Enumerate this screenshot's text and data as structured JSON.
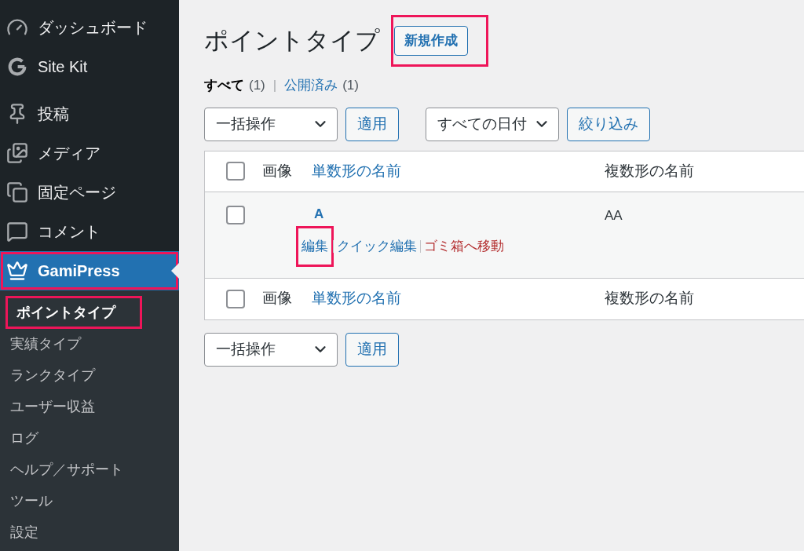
{
  "sidebar": {
    "menu": [
      {
        "label": "ダッシュボード",
        "selected": false,
        "highlighted": false
      },
      {
        "label": "Site Kit",
        "selected": false,
        "highlighted": false
      },
      {
        "label": "投稿",
        "selected": false,
        "highlighted": false
      },
      {
        "label": "メディア",
        "selected": false,
        "highlighted": false
      },
      {
        "label": "固定ページ",
        "selected": false,
        "highlighted": false
      },
      {
        "label": "コメント",
        "selected": false,
        "highlighted": false
      },
      {
        "label": "GamiPress",
        "selected": true,
        "highlighted": true
      }
    ],
    "submenu": [
      {
        "label": "ポイントタイプ",
        "selected": true,
        "highlighted": true
      },
      {
        "label": "実績タイプ",
        "selected": false,
        "highlighted": false
      },
      {
        "label": "ランクタイプ",
        "selected": false,
        "highlighted": false
      },
      {
        "label": "ユーザー収益",
        "selected": false,
        "highlighted": false
      },
      {
        "label": "ログ",
        "selected": false,
        "highlighted": false
      },
      {
        "label": "ヘルプ／サポート",
        "selected": false,
        "highlighted": false
      },
      {
        "label": "ツール",
        "selected": false,
        "highlighted": false
      },
      {
        "label": "設定",
        "selected": false,
        "highlighted": false
      }
    ]
  },
  "page": {
    "title": "ポイントタイプ",
    "add_button": {
      "label": "新規作成",
      "highlighted": true
    },
    "views": [
      {
        "label": "すべて",
        "count": "(1)",
        "selected": true
      },
      {
        "label": "公開済み",
        "count": "(1)",
        "selected": false
      }
    ],
    "views_separator": "|",
    "bulk_action": {
      "value": "一括操作"
    },
    "apply_button": "適用",
    "date_filter": {
      "value": "すべての日付"
    },
    "filter_button": "絞り込み",
    "table": {
      "header": {
        "checked": false,
        "image": "画像",
        "singular": "単数形の名前",
        "plural": "複数形の名前"
      },
      "rows": [
        {
          "checked": false,
          "title": "A",
          "plural": "AA",
          "actions": [
            {
              "label": "編集",
              "kind": "link",
              "highlighted": true
            },
            {
              "label": "クイック編集",
              "kind": "link",
              "highlighted": false
            },
            {
              "label": "ゴミ箱へ移動",
              "kind": "delete",
              "highlighted": false
            }
          ]
        }
      ],
      "footer": {
        "checked": false,
        "image": "画像",
        "singular": "単数形の名前",
        "plural": "複数形の名前"
      }
    },
    "bottom_bulk_action": {
      "value": "一括操作"
    },
    "bottom_apply_button": "適用"
  }
}
